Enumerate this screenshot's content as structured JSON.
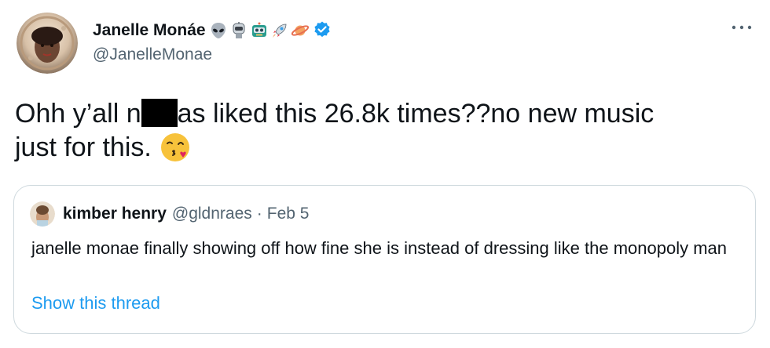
{
  "author": {
    "display_name": "Janelle Monáe",
    "handle": "@JanelleMonae",
    "name_emojis": [
      "alien-emoji",
      "robot-cyborg-emoji",
      "robot-emoji",
      "rocket-emoji",
      "ringed-planet-emoji"
    ],
    "verified_color": "#1d9bf0"
  },
  "tweet": {
    "text_line1_a": "Ohh y’all n",
    "text_line1_b": "as liked this 26.8k times??no new music",
    "text_line2": "just for this.",
    "emoji": "kissing-face-with-heart-emoji"
  },
  "quoted": {
    "name": "kimber henry",
    "handle": "@gldnraes",
    "separator": "·",
    "date": "Feb 5",
    "text": "janelle monae finally showing off how fine she is instead of dressing like the monopoly man",
    "link": "Show this thread",
    "link_color": "#1d9bf0"
  },
  "colors": {
    "text": "#0f1419",
    "secondary": "#536471",
    "border": "#cfd9de"
  }
}
